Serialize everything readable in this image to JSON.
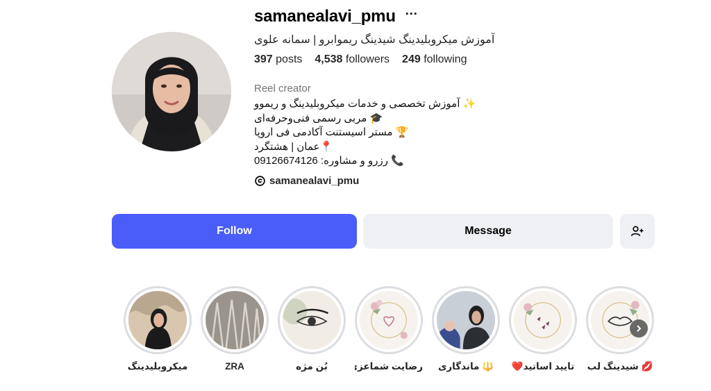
{
  "profile": {
    "username": "samanealavi_pmu",
    "full_name": "آموزش میکروبلیدینگ شیدینگ ریموابرو | سمانه علوی",
    "stats": {
      "posts_count": "397",
      "posts_label": "posts",
      "followers_count": "4,538",
      "followers_label": "followers",
      "following_count": "249",
      "following_label": "following"
    },
    "category": "Reel creator",
    "bio": [
      "✨ آموزش تخصصی و خدمات میکروبلیدینگ و ریموو",
      "🎓 مربی رسمی فنی‌وحرفه‌ای",
      "🏆 مستر اسیستنت آکادمی فی اروپا",
      "📍عمان | هشتگرد",
      "📞 رزرو و مشاوره: 09126674126"
    ],
    "threads_handle": "samanealavi_pmu"
  },
  "actions": {
    "follow_label": "Follow",
    "message_label": "Message",
    "add_user_icon": "person-plus-icon"
  },
  "highlights": [
    {
      "label": "میکروبلیدینگ"
    },
    {
      "label": "ZRA"
    },
    {
      "label": "بُن مژه"
    },
    {
      "label": "رضایت شماعزی..."
    },
    {
      "label": "🔱 ماندگاری"
    },
    {
      "label": "تایید اساتید❤️"
    },
    {
      "label": "💋 شیدینگ لب"
    }
  ],
  "colors": {
    "follow_button": "#4a5df9",
    "secondary_button": "#eff0f3",
    "muted_text": "#737373"
  }
}
